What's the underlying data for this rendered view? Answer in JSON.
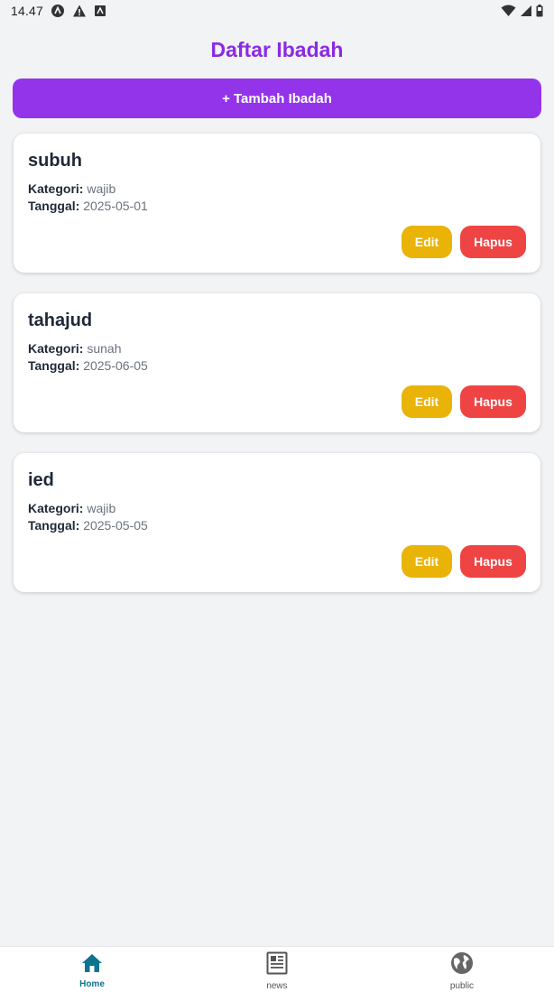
{
  "status_bar": {
    "time": "14.47"
  },
  "header": {
    "title": "Daftar Ibadah"
  },
  "actions": {
    "add_label": "+ Tambah Ibadah"
  },
  "labels": {
    "category": "Kategori:",
    "date": "Tanggal:",
    "edit": "Edit",
    "delete": "Hapus"
  },
  "items": [
    {
      "name": "subuh",
      "category": "wajib",
      "date": "2025-05-01"
    },
    {
      "name": "tahajud",
      "category": "sunah",
      "date": "2025-06-05"
    },
    {
      "name": "ied",
      "category": "wajib",
      "date": "2025-05-05"
    }
  ],
  "nav": [
    {
      "label": "Home",
      "icon": "home-icon",
      "active": true
    },
    {
      "label": "news",
      "icon": "news-icon",
      "active": false
    },
    {
      "label": "public",
      "icon": "globe-icon",
      "active": false
    }
  ],
  "colors": {
    "title": "#8a2be2",
    "primary": "#9333ea",
    "edit": "#eab308",
    "delete": "#ef4444",
    "nav_active": "#0e7490"
  }
}
